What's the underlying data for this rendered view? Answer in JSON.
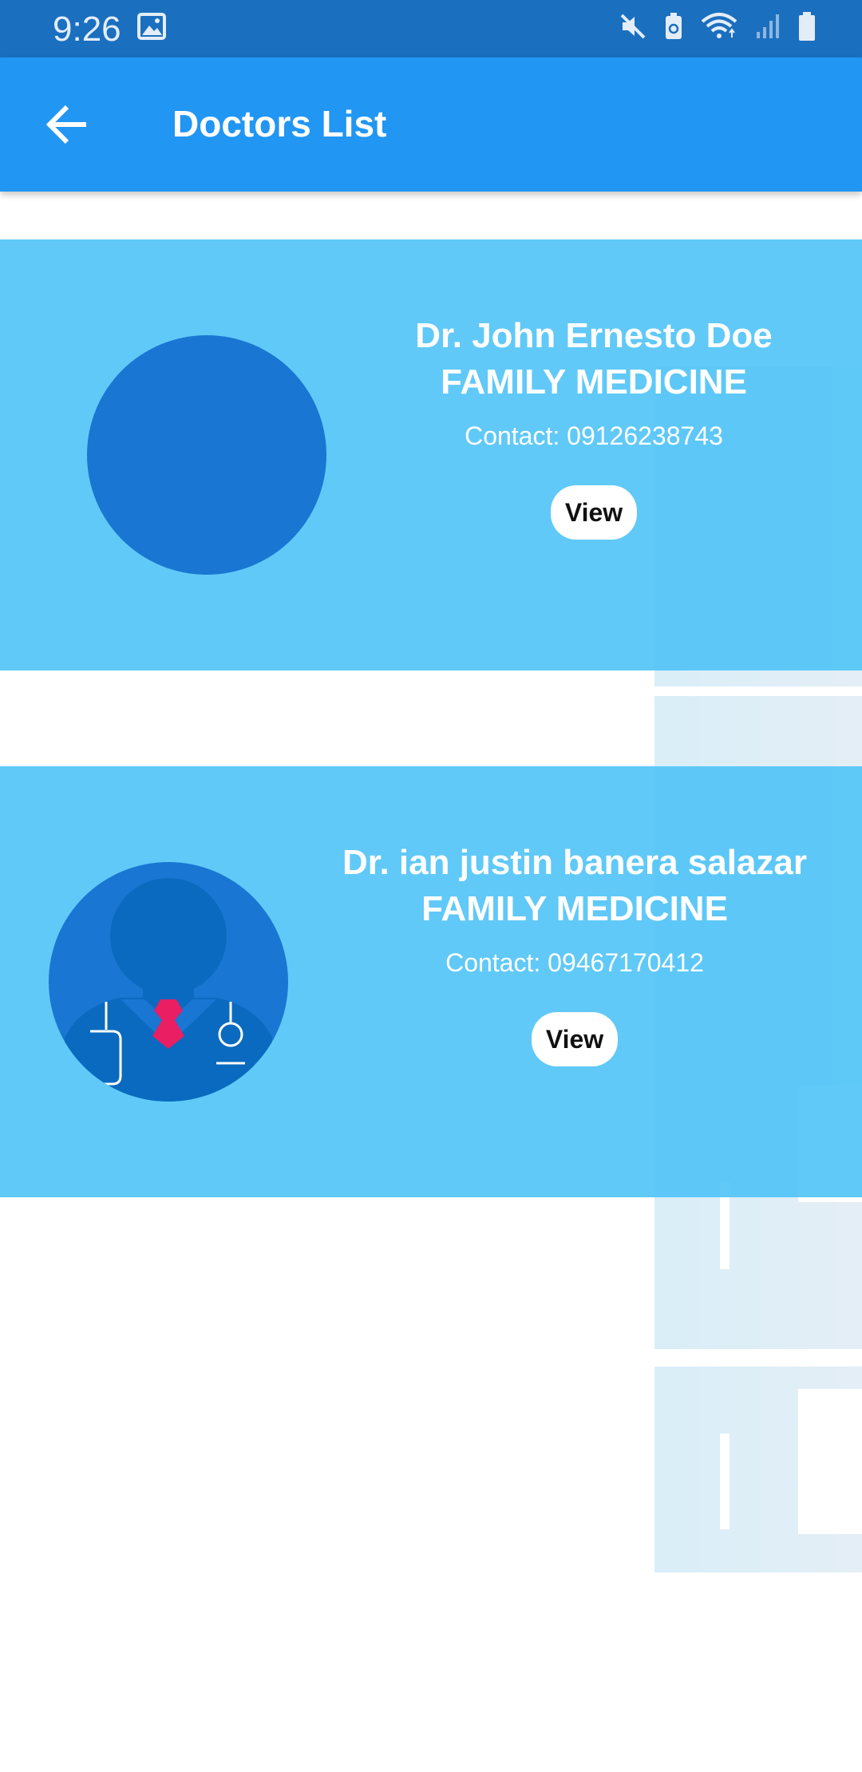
{
  "status_bar": {
    "time": "9:26",
    "icons": [
      "image-icon",
      "mute-icon",
      "battery-saver-icon",
      "wifi-icon",
      "signal-icon",
      "battery-icon"
    ]
  },
  "app_bar": {
    "title": "Doctors List",
    "back_icon": "arrow-left-icon"
  },
  "doctors": [
    {
      "name": "Dr. John Ernesto Doe",
      "specialty": "FAMILY MEDICINE",
      "contact": "Contact: 09126238743",
      "view_label": "View",
      "avatar": "blank"
    },
    {
      "name": "Dr. ian justin banera salazar",
      "specialty": "FAMILY MEDICINE",
      "contact": "Contact: 09467170412",
      "view_label": "View",
      "avatar": "doctor-illustration"
    }
  ],
  "colors": {
    "status_bar": "#1b6fbf",
    "app_bar": "#2196f3",
    "card": "#4fc3f7",
    "avatar": "#1976d2",
    "tie": "#e91e63"
  }
}
